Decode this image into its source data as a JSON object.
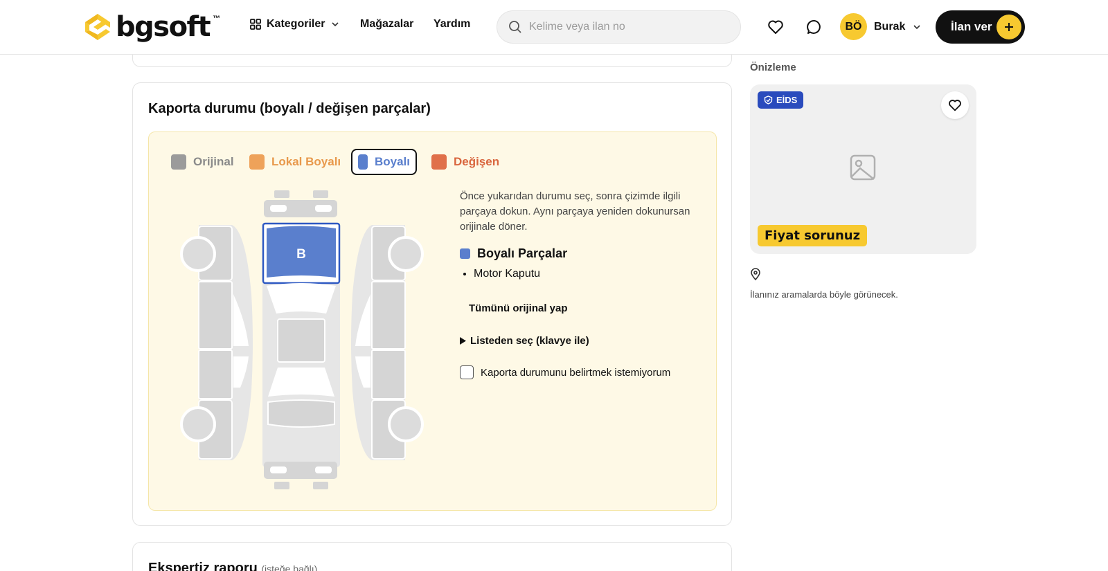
{
  "header": {
    "logo_text": "bgsoft",
    "logo_tm": "™",
    "nav": {
      "categories": "Kategoriler",
      "stores": "Mağazalar",
      "help": "Yardım"
    },
    "search_placeholder": "Kelime veya ilan no",
    "user_initials": "BÖ",
    "user_name": "Burak",
    "post_ad": "İlan ver"
  },
  "body_section": {
    "title": "Kaporta durumu (boyalı / değişen parçalar)",
    "legend": [
      {
        "label": "Orijinal",
        "color": "#9b9b9b",
        "text_color": "#8a8a8a"
      },
      {
        "label": "Lokal Boyalı",
        "color": "#eea25a",
        "text_color": "#e8994c"
      },
      {
        "label": "Boyalı",
        "color": "#5a7fcd",
        "text_color": "#5a7fcd"
      },
      {
        "label": "Değişen",
        "color": "#e0704a",
        "text_color": "#d9663e"
      }
    ],
    "selected_legend": "Boyalı",
    "hood_letter": "B",
    "instructions": "Önce yukarıdan durumu seç, sonra çizimde ilgili parçaya dokun. Aynı parçaya yeniden dokunursan orijinale döner.",
    "parts_heading": "Boyalı Parçalar",
    "parts": [
      "Motor Kaputu"
    ],
    "reset_all": "Tümünü orijinal yap",
    "list_select": "Listeden seç (klavye ile)",
    "opt_out": "Kaporta durumunu belirtmek istemiyorum"
  },
  "next_section": {
    "title": "Ekspertiz raporu",
    "subtitle": "(isteğe bağlı)"
  },
  "preview": {
    "label": "Önizleme",
    "badge": "EİDS",
    "price": "Fiyat sorunuz",
    "note": "İlanınız aramalarda böyle görünecek."
  },
  "colors": {
    "accent_yellow": "#f7c930",
    "badge_blue": "#2a4bbd",
    "painted_blue": "#5a7fcd",
    "original_gray": "#d6d6d6"
  }
}
